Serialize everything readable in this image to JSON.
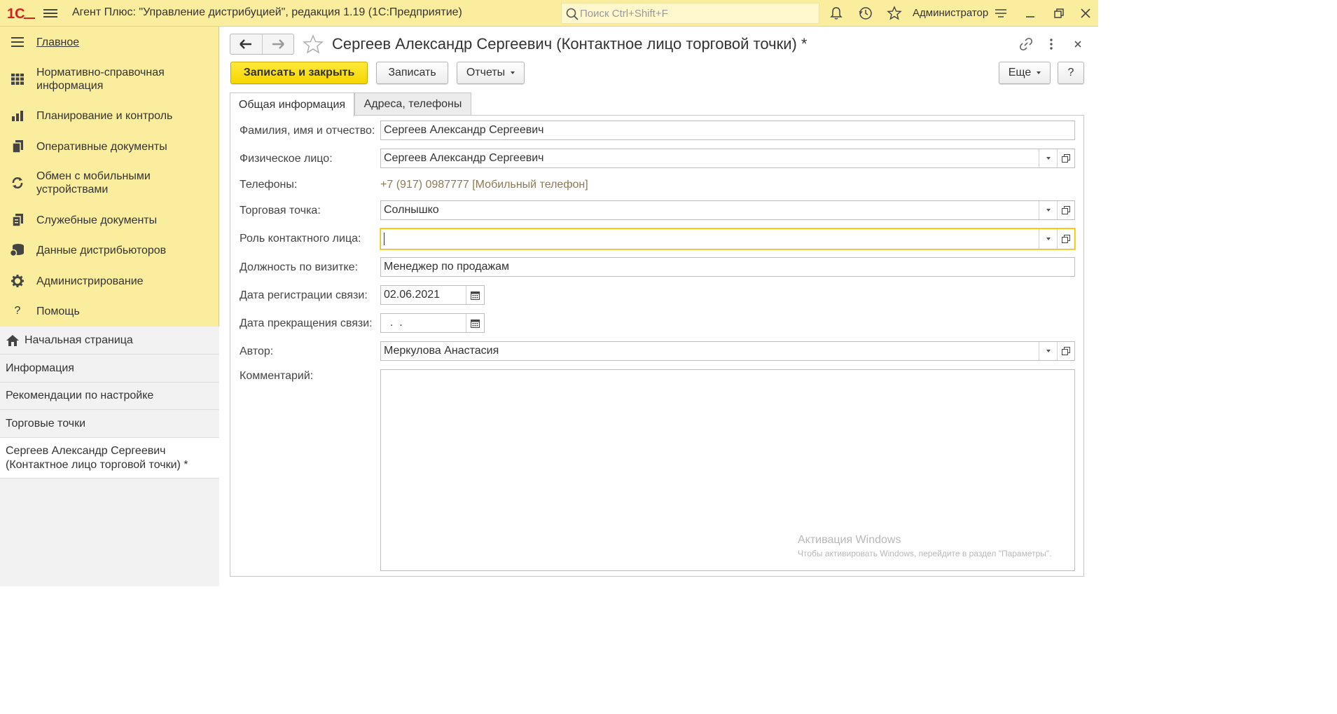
{
  "app": {
    "title": "Агент Плюс: \"Управление дистрибуцией\", редакция 1.19  (1С:Предприятие)",
    "search_placeholder": "Поиск Ctrl+Shift+F",
    "user": "Администратор"
  },
  "sidebar": {
    "items": [
      {
        "label": "Главное",
        "icon": "menu-lines-icon"
      },
      {
        "label": "Нормативно-справочная информация",
        "icon": "grid-icon"
      },
      {
        "label": "Планирование и контроль",
        "icon": "bar-chart-icon"
      },
      {
        "label": "Оперативные документы",
        "icon": "documents-icon"
      },
      {
        "label": "Обмен с мобильными устройствами",
        "icon": "sync-icon"
      },
      {
        "label": "Служебные документы",
        "icon": "service-docs-icon"
      },
      {
        "label": "Данные дистрибьюторов",
        "icon": "database-icon"
      },
      {
        "label": "Администрирование",
        "icon": "gear-icon"
      },
      {
        "label": "Помощь",
        "icon": "help-icon"
      }
    ],
    "open_windows": [
      {
        "label": "Начальная страница",
        "icon": "home-icon"
      },
      {
        "label": "Информация"
      },
      {
        "label": "Рекомендации по настройке"
      },
      {
        "label": "Торговые точки"
      },
      {
        "label": "Сергеев Александр Сергеевич (Контактное лицо торговой точки) *"
      }
    ]
  },
  "form": {
    "title": "Сергеев Александр Сергеевич (Контактное лицо торговой точки) *",
    "buttons": {
      "save_close": "Записать и закрыть",
      "save": "Записать",
      "reports": "Отчеты",
      "more": "Еще",
      "help": "?"
    },
    "tabs": [
      "Общая информация",
      "Адреса, телефоны"
    ],
    "fields": {
      "fio": {
        "label": "Фамилия, имя и отчество:",
        "value": "Сергеев Александр Сергеевич"
      },
      "person": {
        "label": "Физическое лицо:",
        "value": "Сергеев Александр Сергеевич"
      },
      "phones": {
        "label": "Телефоны:",
        "value": "+7 (917) 0987777 [Мобильный телефон]"
      },
      "outlet": {
        "label": "Торговая точка:",
        "value": "Солнышко"
      },
      "role": {
        "label": "Роль контактного лица:",
        "value": ""
      },
      "position": {
        "label": "Должность по визитке:",
        "value": "Менеджер по продажам"
      },
      "reg_date": {
        "label": "Дата регистрации связи:",
        "value": "02.06.2021"
      },
      "end_date": {
        "label": "Дата прекращения связи:",
        "value": "  .  ."
      },
      "author": {
        "label": "Автор:",
        "value": "Меркулова Анастасия"
      },
      "comment": {
        "label": "Комментарий:",
        "value": ""
      }
    }
  },
  "watermark": {
    "line1": "Активация Windows",
    "line2": "Чтобы активировать Windows, перейдите в раздел \"Параметры\"."
  },
  "colors": {
    "accent": "#fbed9e",
    "primary_button": "#f6d500",
    "link": "#8b7a54"
  }
}
